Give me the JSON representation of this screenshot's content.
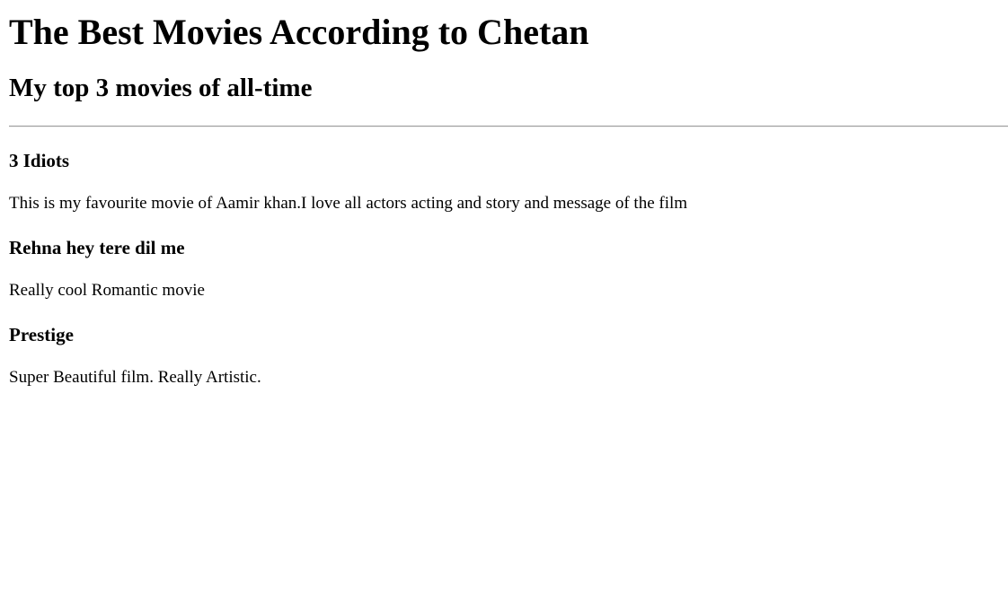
{
  "page": {
    "title": "The Best Movies According to Chetan",
    "subtitle": "My top 3 movies of all-time"
  },
  "movies": [
    {
      "title": "3 Idiots",
      "description": "This is my favourite movie of Aamir khan.I love all actors acting and story and message of the film"
    },
    {
      "title": "Rehna hey tere dil me",
      "description": "Really cool Romantic movie"
    },
    {
      "title": "Prestige",
      "description": "Super Beautiful film. Really Artistic."
    }
  ]
}
